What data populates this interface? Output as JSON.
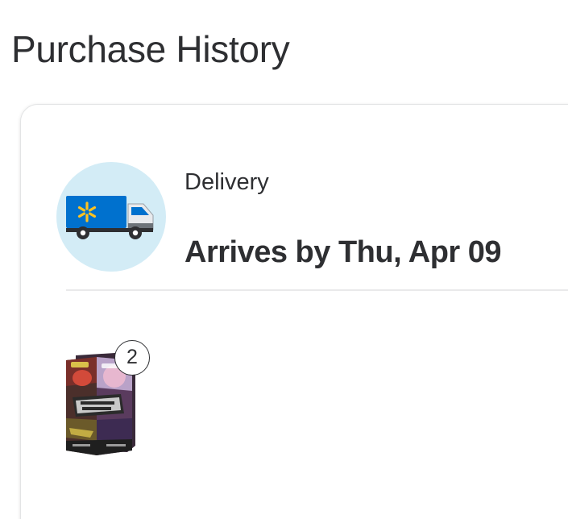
{
  "page": {
    "title": "Purchase History"
  },
  "order": {
    "fulfillment_icon": "walmart-delivery-truck-icon",
    "fulfillment_type": "Delivery",
    "arrival": "Arrives by Thu, Apr 09",
    "items": [
      {
        "image": "pokemon-perfect-order-booster-bundle-thumbnail",
        "quantity": "2"
      }
    ]
  },
  "colors": {
    "walmart_blue": "#0071ce",
    "spark_yellow": "#ffc220",
    "icon_circle": "#d3ecf6",
    "text_primary": "#2e2f32"
  }
}
